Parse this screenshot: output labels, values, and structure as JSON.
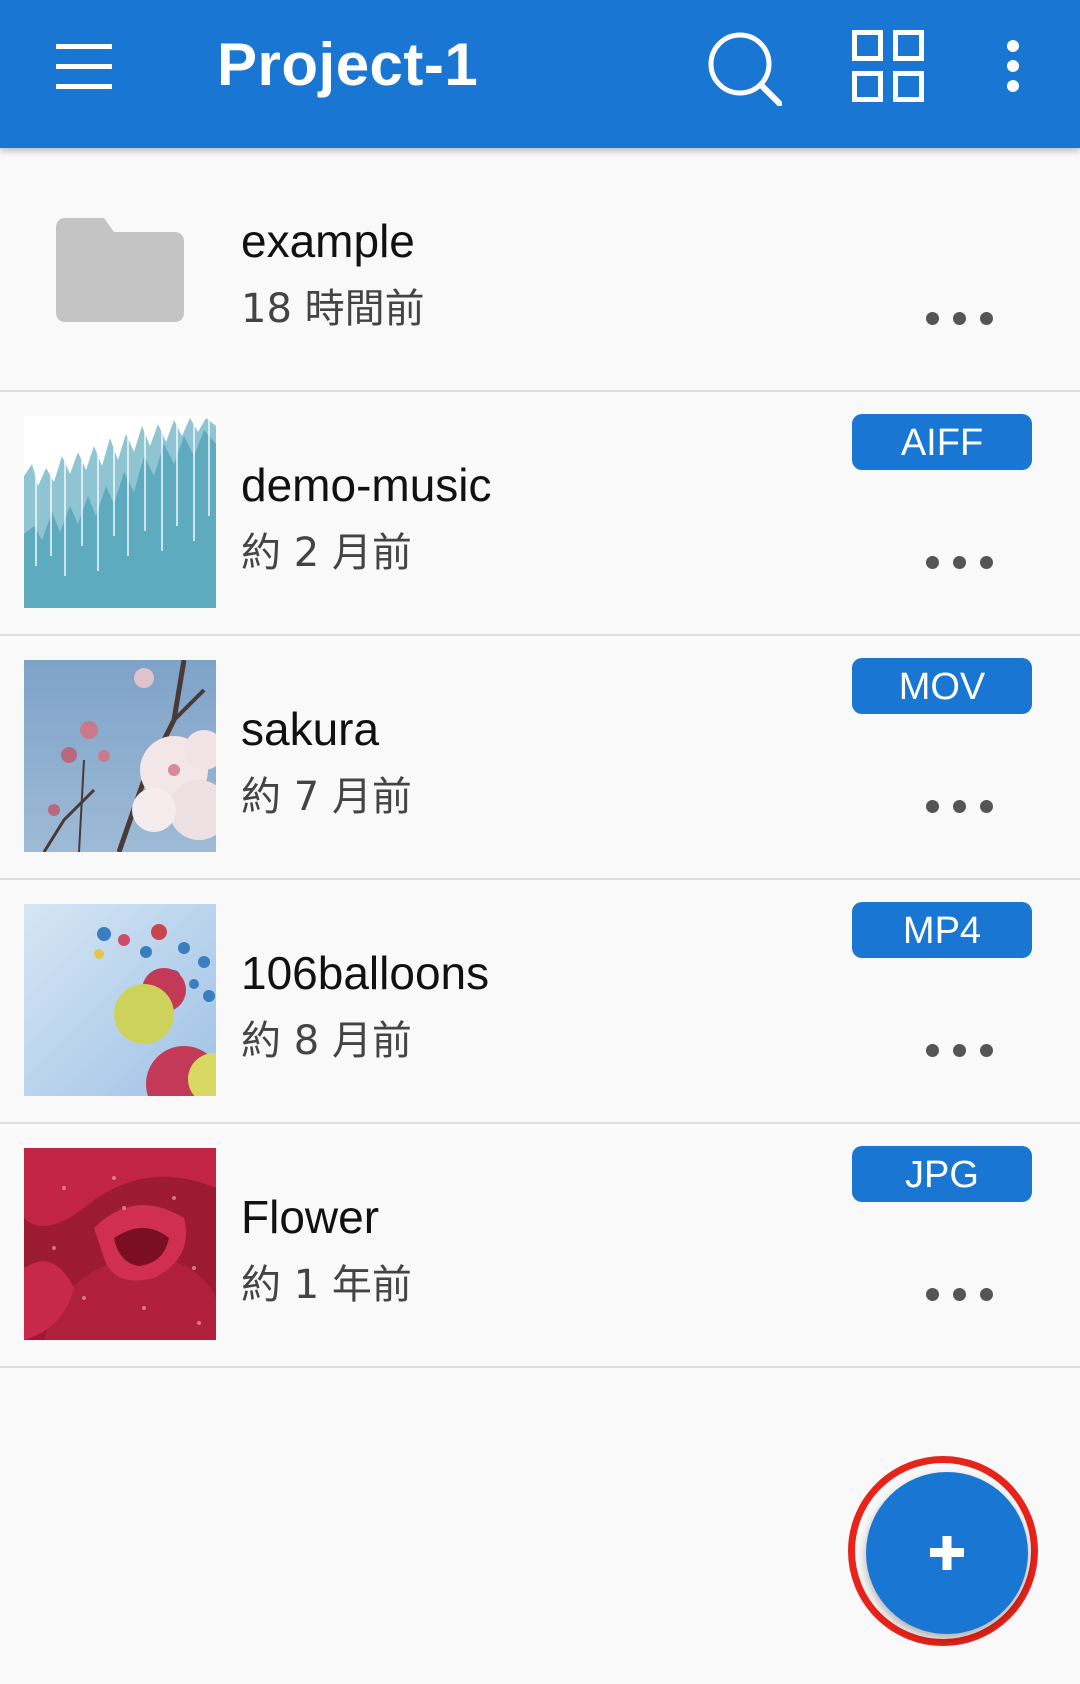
{
  "appbar": {
    "title": "Project-1",
    "menu_icon": "hamburger-menu-icon",
    "search_icon": "search-icon",
    "grid_icon": "grid-view-icon",
    "overflow_icon": "more-vert-icon",
    "background": "#1976d2"
  },
  "items": [
    {
      "name": "example",
      "meta": "18 時間前",
      "badge": "",
      "thumb": "folder-icon"
    },
    {
      "name": "demo-music",
      "meta": "約 2 月前",
      "badge": "AIFF",
      "thumb": "waveform-thumbnail"
    },
    {
      "name": "sakura",
      "meta": "約 7 月前",
      "badge": "MOV",
      "thumb": "cherry-blossom-thumbnail"
    },
    {
      "name": "106balloons",
      "meta": "約 8 月前",
      "badge": "MP4",
      "thumb": "balloons-thumbnail"
    },
    {
      "name": "Flower",
      "meta": "約 1 年前",
      "badge": "JPG",
      "thumb": "rose-thumbnail"
    }
  ],
  "fab": {
    "icon": "plus-icon",
    "highlight_color": "#e8231a"
  }
}
